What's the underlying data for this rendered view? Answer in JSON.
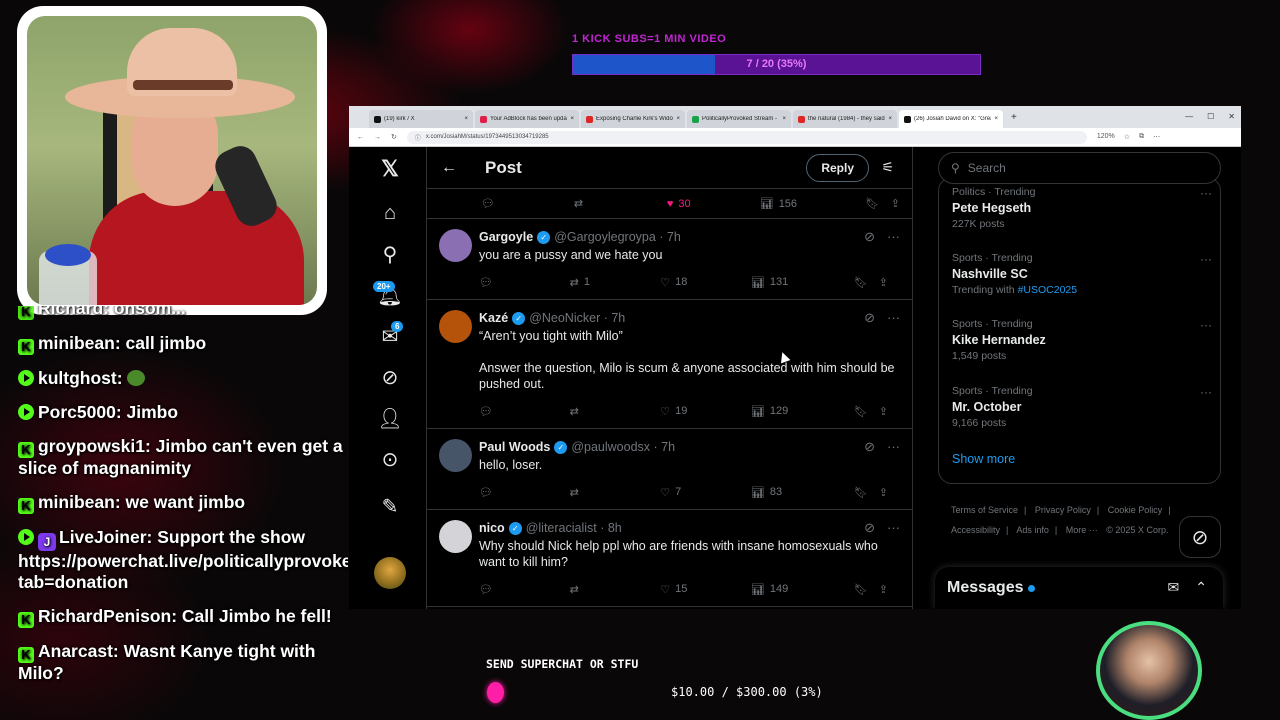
{
  "goal": {
    "title": "1 KICK SUBS=1 MIN VIDEO",
    "progress_text": "7 / 20 (35%)",
    "progress_fraction": 0.35
  },
  "chat": [
    {
      "type": "kick",
      "text": "Richard: ohsom..."
    },
    {
      "type": "kick",
      "text": "minibean: call jimbo"
    },
    {
      "type": "play",
      "text": "kultghost: ",
      "emote": true
    },
    {
      "type": "play",
      "text": "Porc5000: Jimbo"
    },
    {
      "type": "kick",
      "text": "groypowski1: Jimbo can't even get a slice of magnanimity"
    },
    {
      "type": "kick",
      "text": "minibean: we want jimbo"
    },
    {
      "type": "play",
      "badge": true,
      "text": "LiveJoiner: Support the show https://powerchat.live/politicallyprovoked?tab=donation"
    },
    {
      "type": "kick",
      "text": "RichardPenison: Call Jimbo he fell!"
    },
    {
      "type": "kick",
      "text": "Anarcast: Wasnt Kanye tight with Milo?"
    }
  ],
  "browser": {
    "tabs": [
      {
        "label": "(19) kirk / X",
        "color": "#111111"
      },
      {
        "label": "Your AdBlock has been update...",
        "color": "#e11d48"
      },
      {
        "label": "Exposing Charlie Kirk's Widow,...",
        "color": "#dc2626"
      },
      {
        "label": "PoliticallyProvoked Stream - W...",
        "color": "#16a34a"
      },
      {
        "label": "the natural (1984) - they said to...",
        "color": "#dc2626"
      },
      {
        "label": "(26) Josiah David on X: \"Great q...",
        "color": "#111111",
        "active": true
      }
    ],
    "url": "x.com/JosiahM/status/1973449513034719285",
    "zoom": "120%"
  },
  "x": {
    "header_title": "Post",
    "reply_label": "Reply",
    "top_actions": {
      "likes": "30",
      "views": "156"
    },
    "tweets": [
      {
        "name": "Gargoyle",
        "handle": "@Gargoylegroypa · 7h",
        "text": "you are a pussy and we hate you",
        "replies": "",
        "retweets": "1",
        "likes": "18",
        "views": "131",
        "avatar_color": "#8b6fb3"
      },
      {
        "name": "Kazé",
        "handle": "@NeoNicker · 7h",
        "text": "“Aren’t you tight with Milo”\n\nAnswer the question, Milo is scum & anyone associated with him should be pushed out.",
        "replies": "",
        "retweets": "",
        "likes": "19",
        "views": "129",
        "avatar_color": "#b45309"
      },
      {
        "name": "Paul Woods",
        "handle": "@paulwoodsx · 7h",
        "text": "hello, loser.",
        "replies": "",
        "retweets": "",
        "likes": "7",
        "views": "83",
        "avatar_color": "#475569"
      },
      {
        "name": "nico",
        "handle": "@literacialist · 8h",
        "text": "Why should Nick help ppl who are friends with insane homosexuals who want to kill him?",
        "replies": "",
        "retweets": "",
        "likes": "15",
        "views": "149",
        "avatar_color": "#d4d4d8"
      }
    ],
    "search_placeholder": "Search",
    "trends": [
      {
        "meta": "Politics · Trending",
        "name": "Pete Hegseth",
        "count": "227K posts"
      },
      {
        "meta": "Sports · Trending",
        "name": "Nashville SC",
        "count_prefix": "Trending with ",
        "hashtag": "#USOC2025"
      },
      {
        "meta": "Sports · Trending",
        "name": "Kike Hernandez",
        "count": "1,549 posts"
      },
      {
        "meta": "Sports · Trending",
        "name": "Mr. October",
        "count": "9,166 posts"
      }
    ],
    "show_more": "Show more",
    "footer": [
      "Terms of Service",
      "|",
      "Privacy Policy",
      "|",
      "Cookie Policy",
      "|",
      "Accessibility",
      "|",
      "Ads info",
      "|",
      "More ···",
      "© 2025 X Corp."
    ],
    "messages_title": "Messages",
    "nav_badges": {
      "notifications": "20+",
      "messages": "6"
    }
  },
  "superchat": {
    "label": "SEND SUPERCHAT OR STFU",
    "amount": "$10.00 / $300.00 (3%)",
    "progress_fraction": 0.03
  },
  "colors": {
    "x_blue": "#1d9bf0",
    "like_pink": "#f91880",
    "kick_green": "#53fc18",
    "goal_blue": "#1e55c8",
    "goal_purple": "#5b1396"
  }
}
